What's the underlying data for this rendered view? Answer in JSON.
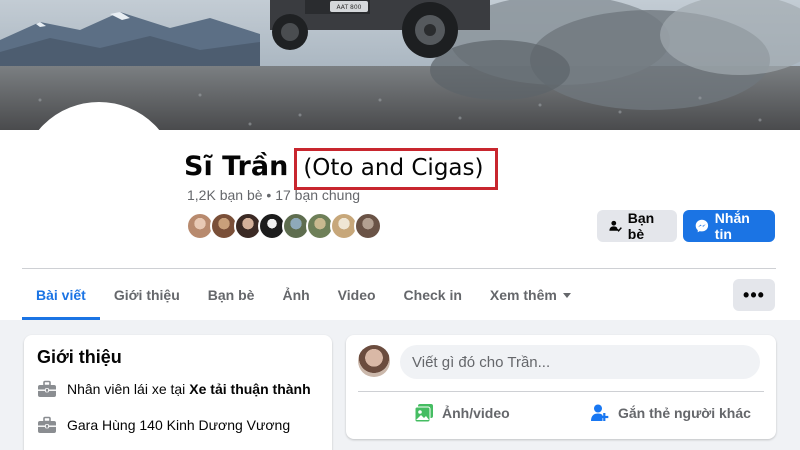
{
  "profile": {
    "name": "Sĩ Trần",
    "alias": "(Oto and Cigas)",
    "friends_summary": "1,2K bạn bè • 17 bạn chung",
    "mutual_friend_count_shown": 8
  },
  "cover": {
    "plate_text": "AAT 800"
  },
  "actions": {
    "friends_label": "Bạn bè",
    "message_label": "Nhắn tin",
    "more_label": "•••"
  },
  "tabs": [
    {
      "label": "Bài viết",
      "active": true
    },
    {
      "label": "Giới thiệu",
      "active": false
    },
    {
      "label": "Bạn bè",
      "active": false
    },
    {
      "label": "Ảnh",
      "active": false
    },
    {
      "label": "Video",
      "active": false
    },
    {
      "label": "Check in",
      "active": false
    },
    {
      "label": "Xem thêm",
      "active": false
    }
  ],
  "intro": {
    "title": "Giới thiệu",
    "job_prefix": "Nhân viên lái xe tại",
    "job_company": "Xe tải thuận thành",
    "workplace": "Gara Hùng 140 Kinh Dương Vương"
  },
  "composer": {
    "placeholder": "Viết gì đó cho Trần...",
    "photo_video_label": "Ảnh/video",
    "tag_label": "Gắn thẻ người khác"
  },
  "colors": {
    "accent": "#1b74e4",
    "highlight_box": "#c8262e"
  }
}
